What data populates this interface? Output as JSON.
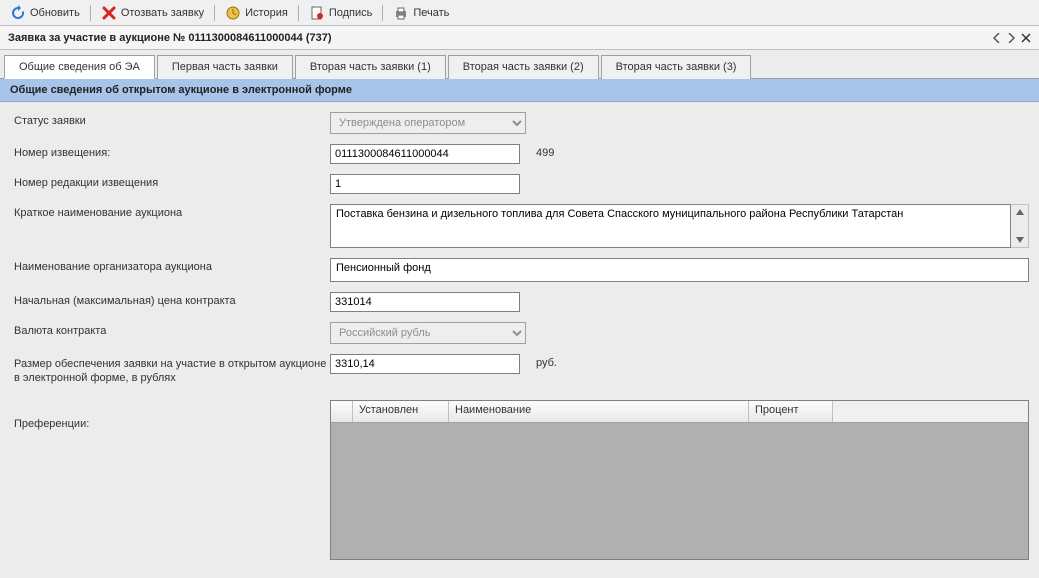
{
  "toolbar": {
    "refresh": "Обновить",
    "withdraw": "Отозвать заявку",
    "history": "История",
    "signature": "Подпись",
    "print": "Печать"
  },
  "titlebar": {
    "text": "Заявка за участие в аукционе № 0111300084611000044 (737)"
  },
  "tabs": [
    "Общие сведения об ЭА",
    "Первая часть заявки",
    "Вторая часть заявки (1)",
    "Вторая часть заявки (2)",
    "Вторая часть заявки (3)"
  ],
  "section": {
    "header": "Общие сведения об открытом аукционе в электронной форме"
  },
  "form": {
    "status_label": "Статус заявки",
    "status_value": "Утверждена оператором",
    "notice_no_label": "Номер извещения:",
    "notice_no_value": "0111300084611000044",
    "notice_no_extra": "499",
    "revision_label": "Номер редакции извещения",
    "revision_value": "1",
    "short_name_label": "Краткое наименование аукциона",
    "short_name_value": "Поставка бензина и дизельного топлива для Совета Спасского муниципального района Республики Татарстан",
    "organizer_label": "Наименование организатора аукциона",
    "organizer_value": "Пенсионный фонд",
    "start_price_label": "Начальная (максимальная) цена контракта",
    "start_price_value": "331014",
    "currency_label": "Валюта контракта",
    "currency_value": "Российский рубль",
    "deposit_label": "Размер обеспечения заявки на участие в открытом аукционе в электронной форме, в рублях",
    "deposit_value": "3310,14",
    "deposit_unit": "руб.",
    "preferences_label": "Преференции:"
  },
  "pref_table": {
    "col1": "Установлен",
    "col2": "Наименование",
    "col3": "Процент"
  }
}
